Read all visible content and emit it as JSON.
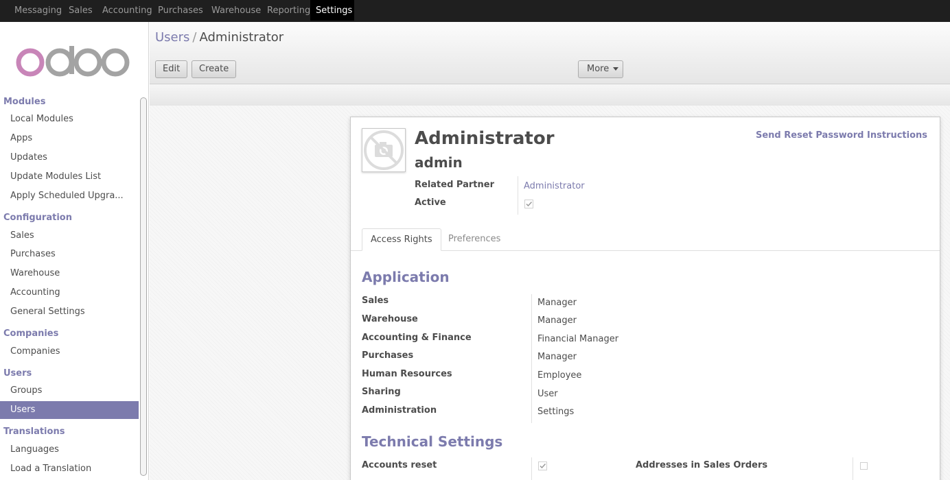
{
  "topbar": {
    "menus": [
      "Messaging",
      "Sales",
      "Accounting",
      "Purchases",
      "Warehouse",
      "Reporting",
      "Settings"
    ]
  },
  "sidebar": {
    "logo_text": "odoo",
    "sections": {
      "modules": "Modules",
      "configuration": "Configuration",
      "companies": "Companies",
      "users": "Users",
      "translations": "Translations"
    },
    "items": {
      "local_modules": "Local Modules",
      "apps": "Apps",
      "updates": "Updates",
      "update_modules_list": "Update Modules List",
      "apply_upgrades": "Apply Scheduled Upgra...",
      "sales": "Sales",
      "purchases": "Purchases",
      "warehouse": "Warehouse",
      "accounting": "Accounting",
      "general_settings": "General Settings",
      "companies": "Companies",
      "groups": "Groups",
      "users": "Users",
      "languages": "Languages",
      "load_translation": "Load a Translation"
    }
  },
  "control_panel": {
    "breadcrumb_parent": "Users",
    "breadcrumb_separator": "/",
    "breadcrumb_current": "Administrator",
    "edit_label": "Edit",
    "create_label": "Create",
    "more_label": "More"
  },
  "form": {
    "name": "Administrator",
    "login": "admin",
    "reset_link": "Send Reset Password Instructions",
    "related_partner_label": "Related Partner",
    "related_partner_value": "Administrator",
    "active_label": "Active",
    "active_checked": true,
    "tabs": [
      "Access Rights",
      "Preferences"
    ],
    "application_title": "Application",
    "application_rows": [
      {
        "label": "Sales",
        "value": "Manager"
      },
      {
        "label": "Warehouse",
        "value": "Manager"
      },
      {
        "label": "Accounting & Finance",
        "value": "Financial Manager"
      },
      {
        "label": "Purchases",
        "value": "Manager"
      },
      {
        "label": "Human Resources",
        "value": "Employee"
      },
      {
        "label": "Sharing",
        "value": "User"
      },
      {
        "label": "Administration",
        "value": "Settings"
      }
    ],
    "technical_title": "Technical Settings",
    "technical_rows": [
      {
        "label": "Accounts reset",
        "checked": true
      },
      {
        "label": "Addresses in Sales Orders",
        "checked": false
      }
    ]
  },
  "colors": {
    "accent": "#7c7bad",
    "topbar_bg": "#1f1f1f",
    "logo_pink": "#c885b8",
    "logo_grey": "#a3a3a3"
  }
}
